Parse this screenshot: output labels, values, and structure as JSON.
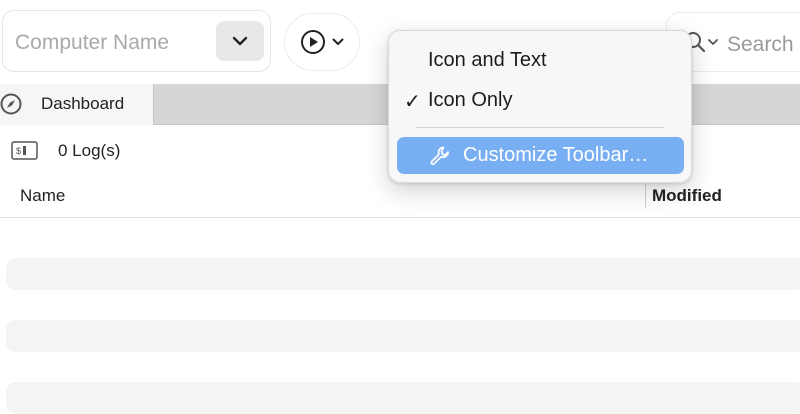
{
  "toolbar": {
    "computer_placeholder": "Computer Name",
    "search_placeholder": "Search"
  },
  "tabs": [
    {
      "label": "Dashboard",
      "icon": "compass-icon"
    }
  ],
  "logs": {
    "count_text": "0 Log(s)",
    "icon": "log-file-icon"
  },
  "table": {
    "columns": [
      "Name",
      "Modified"
    ],
    "rows": []
  },
  "menu": {
    "items": [
      {
        "label": "Icon and Text",
        "checked": false
      },
      {
        "label": "Icon Only",
        "checked": true
      },
      {
        "label": "Customize Toolbar…",
        "highlighted": true,
        "icon": "wrench-icon"
      }
    ],
    "check_glyph": "✓"
  },
  "colors": {
    "menu_highlight": "#78aef2",
    "tabbar_bg": "#d6d6d6"
  }
}
